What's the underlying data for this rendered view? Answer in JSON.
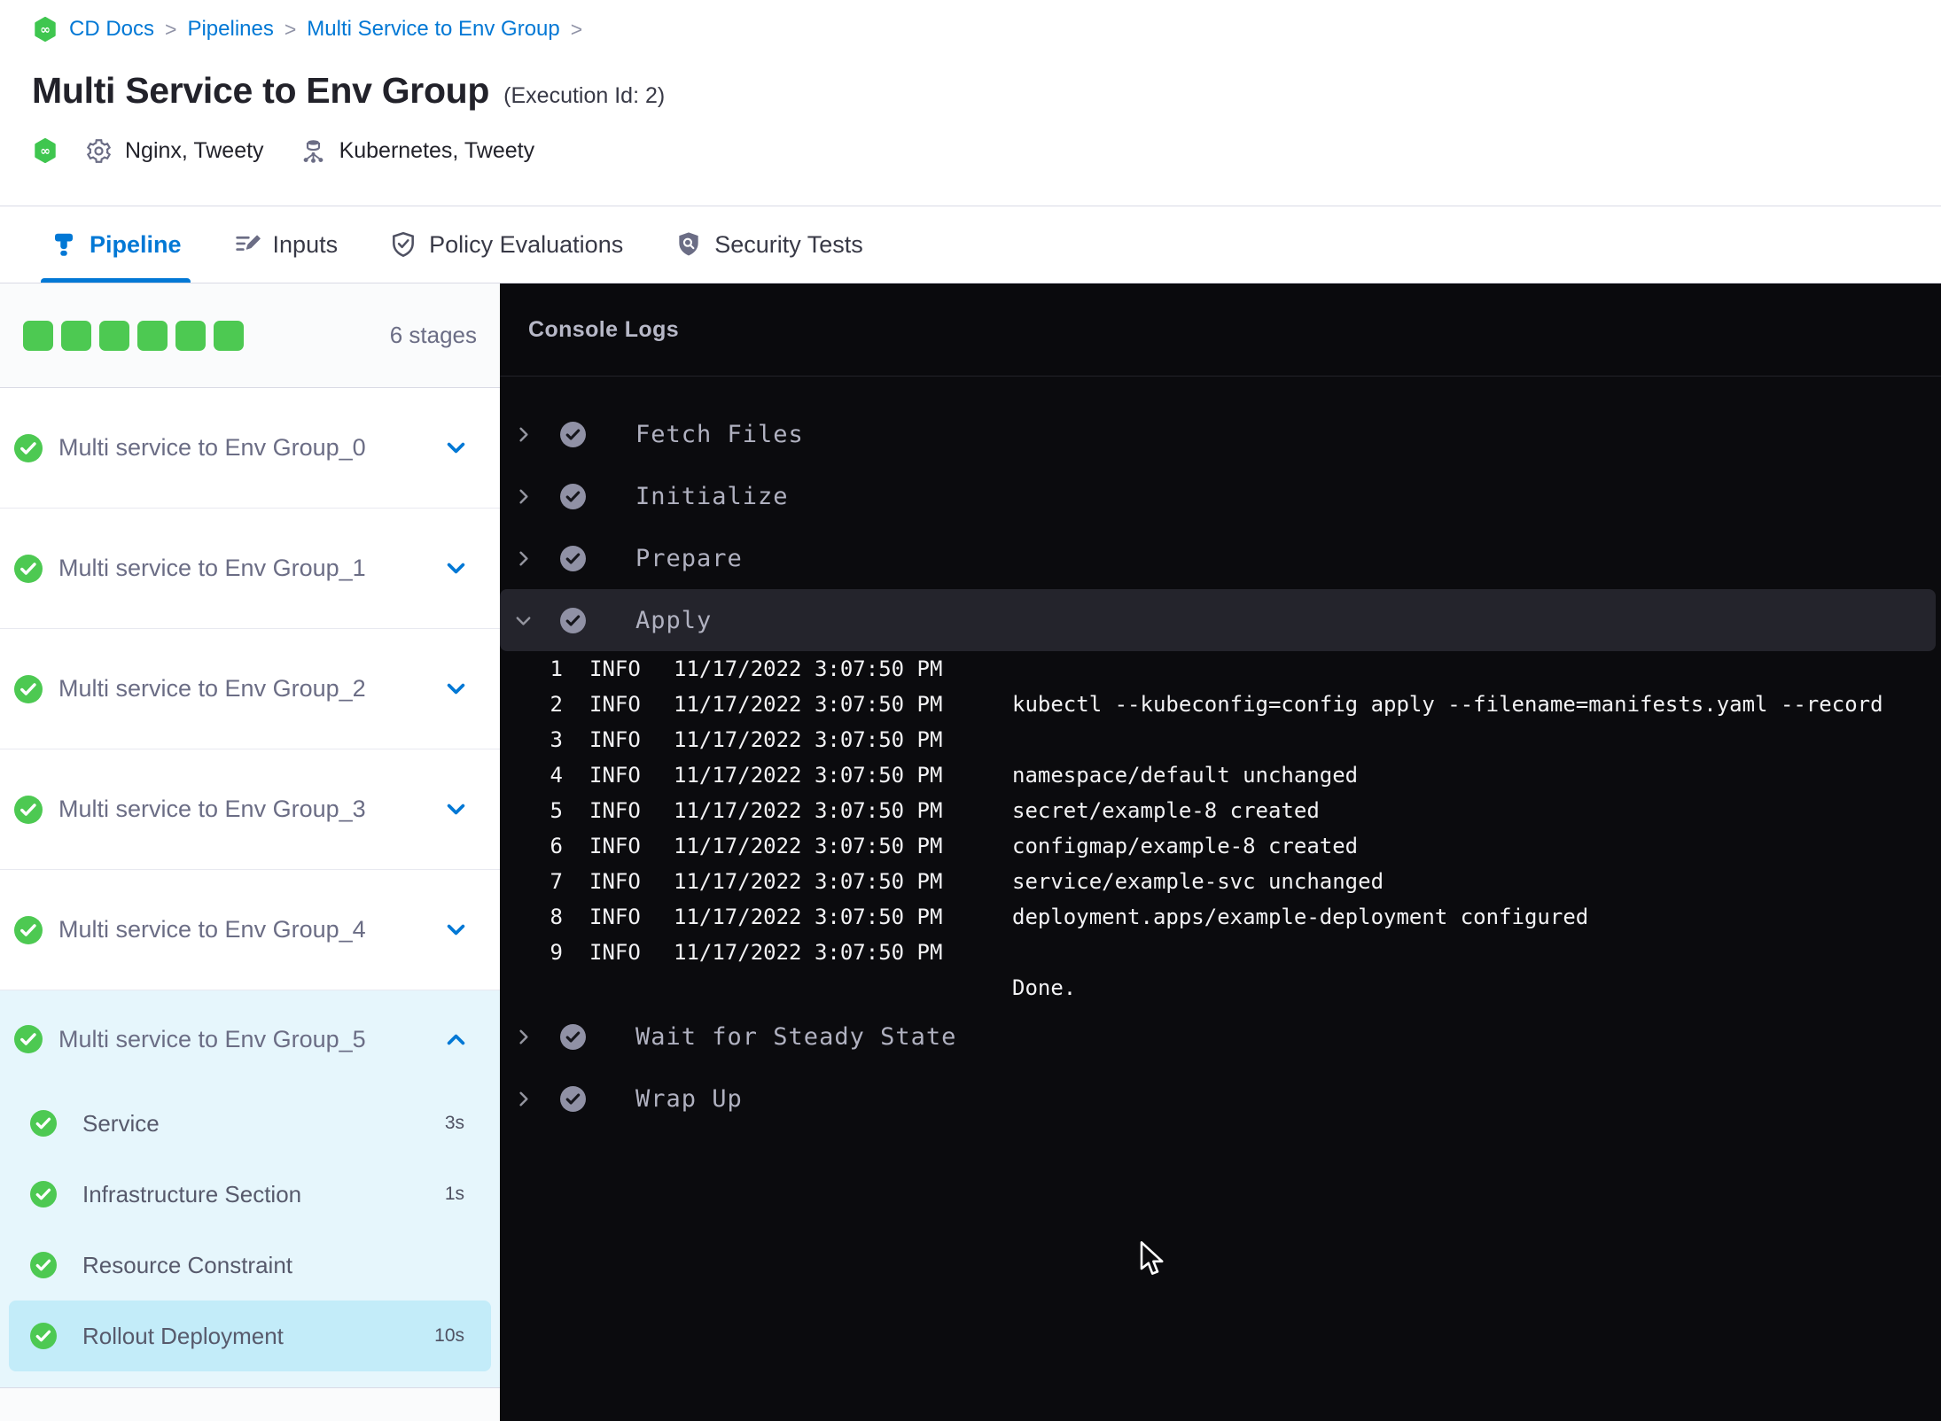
{
  "breadcrumb": {
    "items": [
      "CD Docs",
      "Pipelines",
      "Multi Service to Env Group"
    ],
    "separator": ">"
  },
  "header": {
    "title": "Multi Service to Env Group",
    "execution_id": "(Execution Id: 2)",
    "services": "Nginx, Tweety",
    "infrastructure": "Kubernetes, Tweety"
  },
  "tabs": [
    {
      "label": "Pipeline",
      "icon": "pipeline-icon",
      "active": true
    },
    {
      "label": "Inputs",
      "icon": "inputs-icon",
      "active": false
    },
    {
      "label": "Policy Evaluations",
      "icon": "policy-shield-check-icon",
      "active": false
    },
    {
      "label": "Security Tests",
      "icon": "security-shield-search-icon",
      "active": false
    }
  ],
  "sidebar": {
    "stages_count_label": "6 stages",
    "progress_squares": 6,
    "stages": [
      {
        "label": "Multi service to Env Group_0",
        "status": "success",
        "expanded": false
      },
      {
        "label": "Multi service to Env Group_1",
        "status": "success",
        "expanded": false
      },
      {
        "label": "Multi service to Env Group_2",
        "status": "success",
        "expanded": false
      },
      {
        "label": "Multi service to Env Group_3",
        "status": "success",
        "expanded": false
      },
      {
        "label": "Multi service to Env Group_4",
        "status": "success",
        "expanded": false
      },
      {
        "label": "Multi service to Env Group_5",
        "status": "success",
        "expanded": true,
        "steps": [
          {
            "label": "Service",
            "duration": "3s",
            "status": "success",
            "selected": false
          },
          {
            "label": "Infrastructure Section",
            "duration": "1s",
            "status": "success",
            "selected": false
          },
          {
            "label": "Resource Constraint",
            "duration": "",
            "status": "success",
            "selected": false
          },
          {
            "label": "Rollout Deployment",
            "duration": "10s",
            "status": "success",
            "selected": true
          }
        ]
      }
    ]
  },
  "console": {
    "title": "Console Logs",
    "steps": [
      {
        "label": "Fetch Files",
        "status": "success",
        "expanded": false
      },
      {
        "label": "Initialize",
        "status": "success",
        "expanded": false
      },
      {
        "label": "Prepare",
        "status": "success",
        "expanded": false
      },
      {
        "label": "Apply",
        "status": "success",
        "expanded": true,
        "logs": [
          {
            "n": "1",
            "level": "INFO",
            "time": "11/17/2022 3:07:50 PM",
            "msg": ""
          },
          {
            "n": "2",
            "level": "INFO",
            "time": "11/17/2022 3:07:50 PM",
            "msg": "kubectl --kubeconfig=config apply --filename=manifests.yaml --record"
          },
          {
            "n": "3",
            "level": "INFO",
            "time": "11/17/2022 3:07:50 PM",
            "msg": ""
          },
          {
            "n": "4",
            "level": "INFO",
            "time": "11/17/2022 3:07:50 PM",
            "msg": "namespace/default unchanged"
          },
          {
            "n": "5",
            "level": "INFO",
            "time": "11/17/2022 3:07:50 PM",
            "msg": "secret/example-8 created"
          },
          {
            "n": "6",
            "level": "INFO",
            "time": "11/17/2022 3:07:50 PM",
            "msg": "configmap/example-8 created"
          },
          {
            "n": "7",
            "level": "INFO",
            "time": "11/17/2022 3:07:50 PM",
            "msg": "service/example-svc unchanged"
          },
          {
            "n": "8",
            "level": "INFO",
            "time": "11/17/2022 3:07:50 PM",
            "msg": "deployment.apps/example-deployment configured"
          },
          {
            "n": "9",
            "level": "INFO",
            "time": "11/17/2022 3:07:50 PM",
            "msg": ""
          },
          {
            "n": "",
            "level": "",
            "time": "",
            "msg": "Done."
          }
        ]
      },
      {
        "label": "Wait for Steady State",
        "status": "success",
        "expanded": false
      },
      {
        "label": "Wrap Up",
        "status": "success",
        "expanded": false
      }
    ]
  },
  "colors": {
    "primary_blue": "#0278d5",
    "success_green": "#4DC952",
    "console_bg": "#0b0b0e",
    "expanded_step_bg": "#24242c",
    "expanded_stage_bg": "#e6f6fc",
    "selected_substep_bg": "#c3ecf9"
  }
}
